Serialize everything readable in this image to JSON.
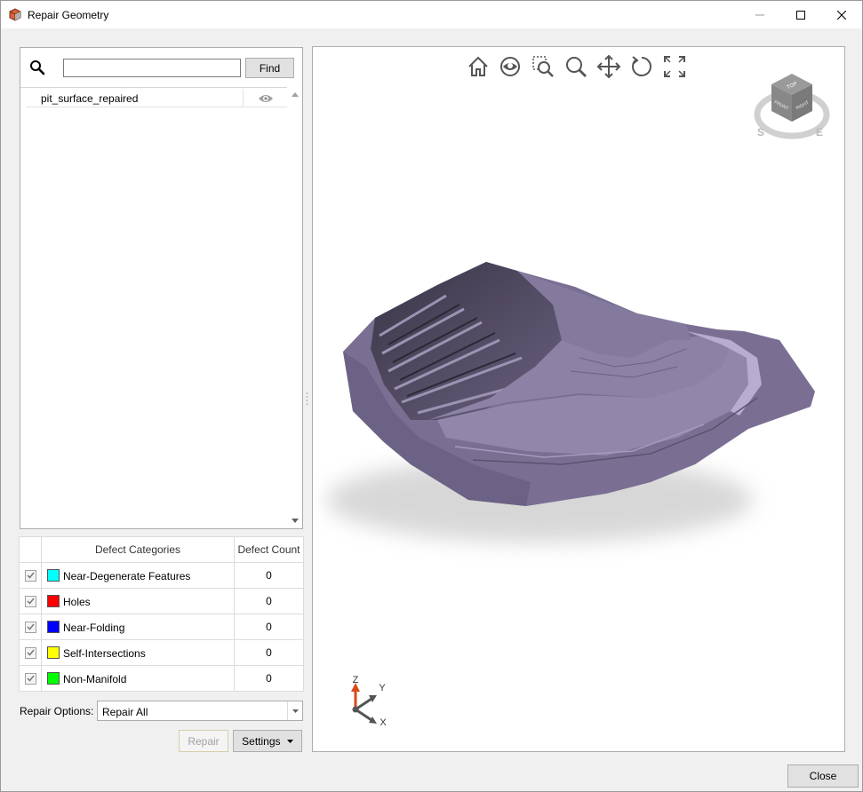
{
  "window": {
    "title": "Repair Geometry"
  },
  "search": {
    "value": "",
    "placeholder": "",
    "find_label": "Find"
  },
  "tree": {
    "items": [
      {
        "label": "pit_surface_repaired",
        "visible": true
      }
    ]
  },
  "defects": {
    "header_category": "Defect Categories",
    "header_count": "Defect Count",
    "rows": [
      {
        "name": "Near-Degenerate Features",
        "color": "#00ffff",
        "count": "0",
        "checked": true
      },
      {
        "name": "Holes",
        "color": "#ff0000",
        "count": "0",
        "checked": true
      },
      {
        "name": "Near-Folding",
        "color": "#0000ff",
        "count": "0",
        "checked": true
      },
      {
        "name": "Self-Intersections",
        "color": "#ffff00",
        "count": "0",
        "checked": true
      },
      {
        "name": "Non-Manifold",
        "color": "#00ff00",
        "count": "0",
        "checked": true
      }
    ]
  },
  "repair": {
    "options_label": "Repair Options:",
    "selected": "Repair All",
    "repair_label": "Repair",
    "settings_label": "Settings"
  },
  "footer": {
    "close_label": "Close"
  },
  "viewport": {
    "toolbar": [
      "home-icon",
      "orbit-icon",
      "zoom-box-icon",
      "zoom-icon",
      "pan-icon",
      "rotate-icon",
      "fullscreen-icon"
    ],
    "viewcube": {
      "top": "TOP",
      "front": "FRONT",
      "right": "RIGHT",
      "south": "S",
      "east": "E"
    },
    "axes": {
      "z": "Z",
      "y": "Y",
      "x": "X"
    },
    "mesh_color": "#7a6f93"
  }
}
